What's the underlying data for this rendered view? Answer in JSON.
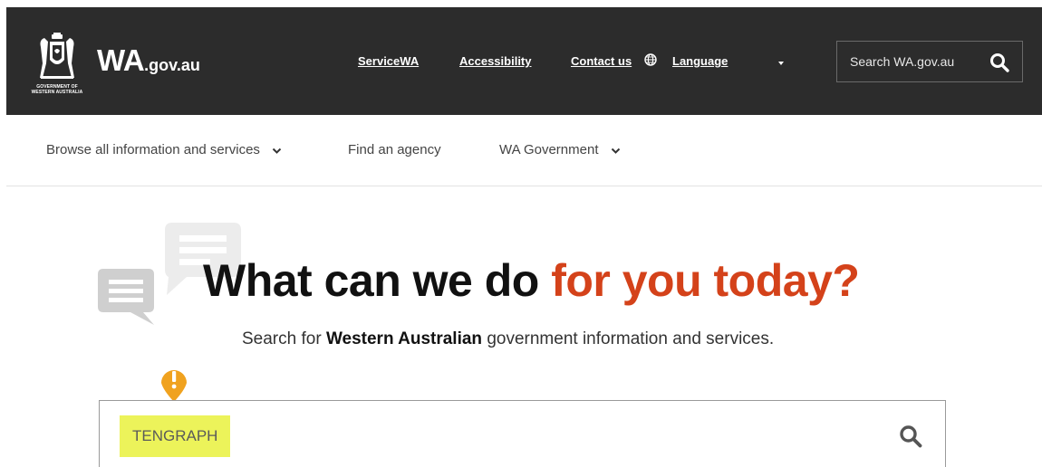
{
  "header": {
    "crest_caption": "GOVERNMENT OF WESTERN AUSTRALIA",
    "wordmark_main": "WA",
    "wordmark_sub": ".gov.au",
    "links": {
      "servicewa": "ServiceWA",
      "accessibility": "Accessibility",
      "contact": "Contact us",
      "language": "Language"
    },
    "search_placeholder": "Search WA.gov.au",
    "background_color": "#2c2c2c"
  },
  "nav": {
    "browse": "Browse all information and services",
    "agency": "Find an agency",
    "government": "WA Government"
  },
  "hero": {
    "headline_dark": "What can we do ",
    "headline_accent": "for you today?",
    "accent_color": "#d4421a",
    "tagline_pre": "Search for ",
    "tagline_bold": "Western Australian",
    "tagline_post": " government information and services.",
    "search_value": "TENGRAPH",
    "highlight_color": "#ecf35a",
    "pin_color": "#f0a21f"
  }
}
